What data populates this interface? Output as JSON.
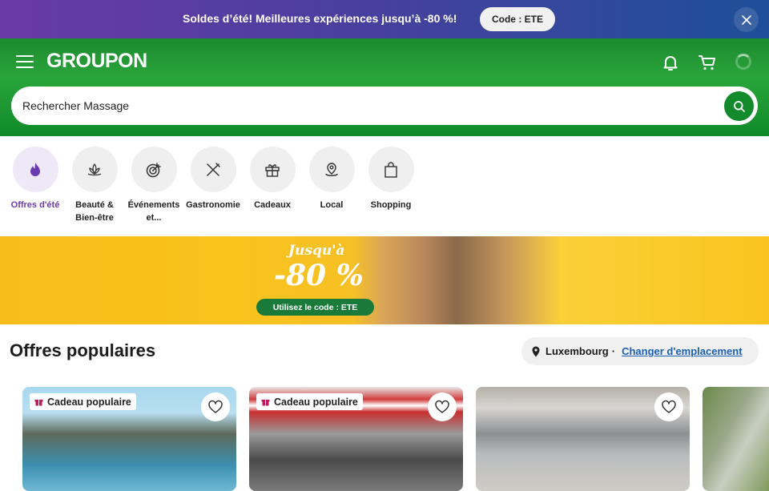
{
  "promo": {
    "text": "Soldes d’été! Meilleures expériences jusqu’à -80 %!",
    "code_label": "Code : ETE",
    "close_icon": "close-icon"
  },
  "header": {
    "logo": "GROUPON",
    "menu_icon": "hamburger-icon",
    "icons": [
      "bell-icon",
      "cart-icon",
      "loading-spinner-icon"
    ]
  },
  "search": {
    "placeholder": "Rechercher Massage",
    "button_icon": "search-icon"
  },
  "categories": [
    {
      "label": "Offres d'été",
      "icon": "flame-icon",
      "active": true
    },
    {
      "label": "Beauté & Bien-être",
      "icon": "lotus-icon"
    },
    {
      "label": "Événements et...",
      "icon": "target-icon"
    },
    {
      "label": "Gastronomie",
      "icon": "utensils-icon"
    },
    {
      "label": "Cadeaux",
      "icon": "gift-icon"
    },
    {
      "label": "Local",
      "icon": "map-pin-icon"
    },
    {
      "label": "Shopping",
      "icon": "shopping-bag-icon"
    }
  ],
  "banner": {
    "heading": "Jusqu'à",
    "discount": "-80 %",
    "code_text": "Utilisez le code : ETE"
  },
  "popular": {
    "title": "Offres populaires",
    "location_city": "Luxembourg",
    "location_sep": "·",
    "location_link": "Changer d'emplacement"
  },
  "cards": [
    {
      "badge": "Cadeau populaire"
    },
    {
      "badge": "Cadeau populaire"
    },
    {
      "badge": ""
    },
    {
      "badge": ""
    }
  ],
  "colors": {
    "brand_green": "#1d8a2f",
    "accent_purple": "#6b3bb0",
    "link_blue": "#1a5fb4",
    "banner_yellow": "#f9c21d"
  }
}
